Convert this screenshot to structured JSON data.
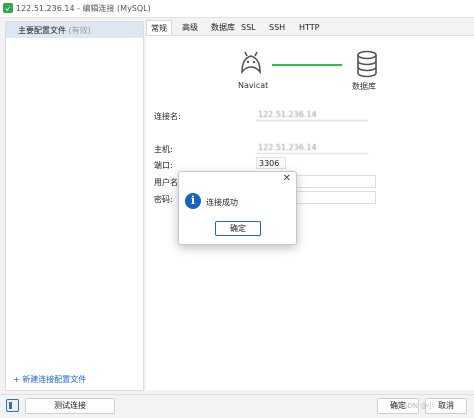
{
  "window": {
    "title": "122.51.236.14 - 编辑连接 (MySQL)"
  },
  "left_panel": {
    "profile_label": "主要配置文件",
    "profile_sub": "(有效)",
    "new_profile_link": "+ 新建连接配置文件"
  },
  "tabs": [
    {
      "label": "常规",
      "active": true
    },
    {
      "label": "高级",
      "active": false
    },
    {
      "label": "数据库",
      "active": false
    },
    {
      "label": "SSL",
      "active": false
    },
    {
      "label": "SSH",
      "active": false
    },
    {
      "label": "HTTP",
      "active": false
    }
  ],
  "diagram": {
    "left_label": "Navicat",
    "right_label": "数据库",
    "left_icon": "navicat-icon",
    "right_icon": "database-icon",
    "line_color": "#2fbf4d"
  },
  "form": {
    "conn_name_label": "连接名:",
    "conn_name_value": "122.51.236.14",
    "host_label": "主机:",
    "host_value": "122.51.236.14",
    "port_label": "端口:",
    "port_value": "3306",
    "user_label": "用户名",
    "password_label": "密码:"
  },
  "dialog": {
    "message": "连接成功",
    "ok_label": "确定",
    "icon": "info-icon",
    "accent": "#1565c0"
  },
  "bottom": {
    "test_label": "测试连接",
    "ok_label": "确定",
    "cancel_label": "取消",
    "watermark": "CSDN @小 一 事"
  }
}
